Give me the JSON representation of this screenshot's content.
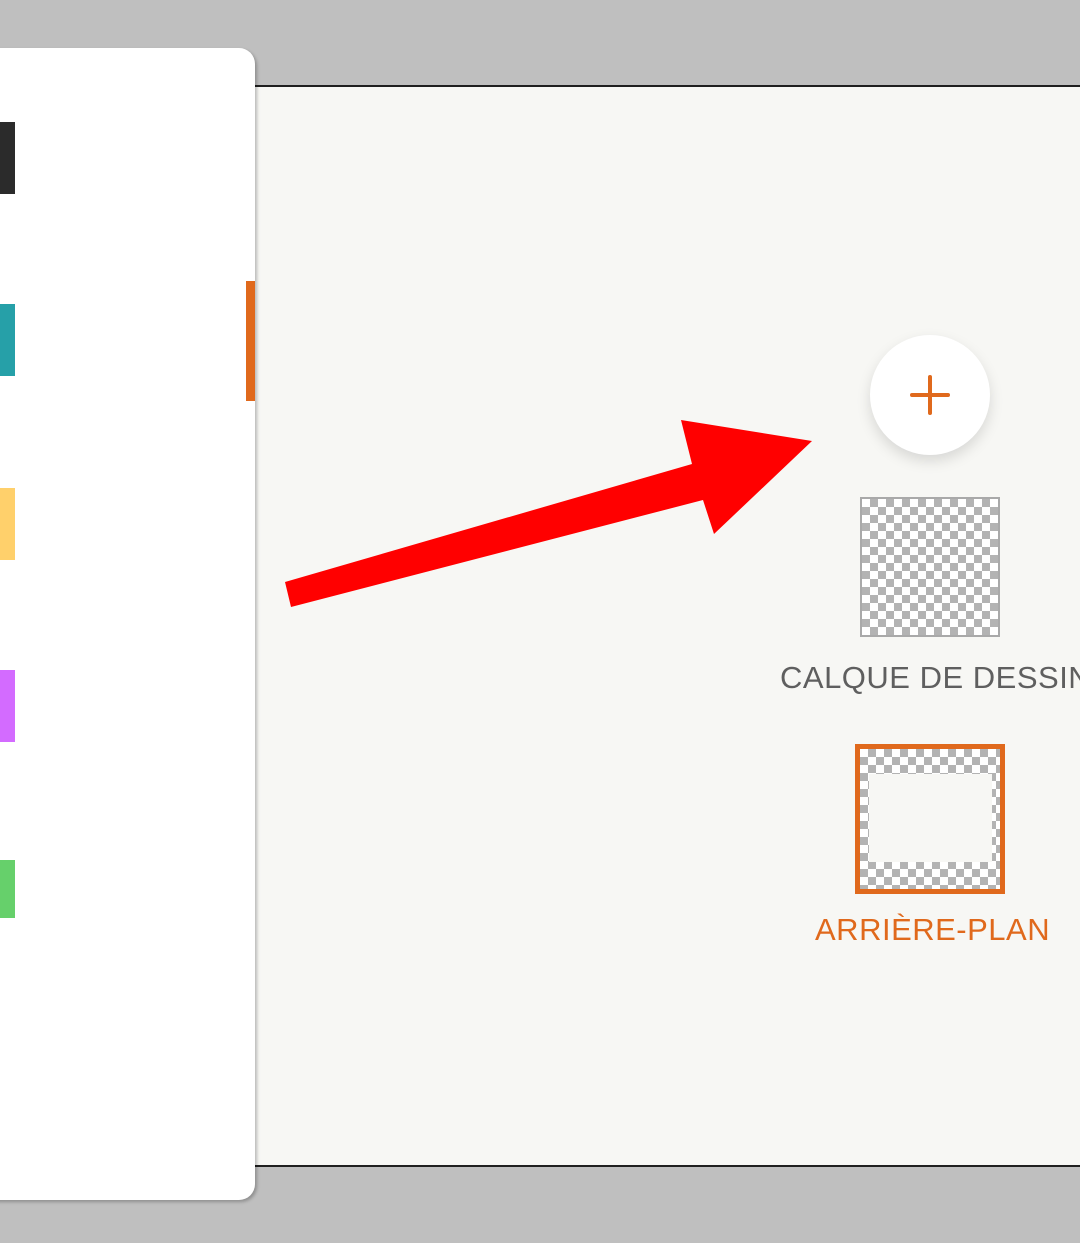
{
  "colors": {
    "accent": "#e0691c",
    "annotation_arrow": "#ff0000",
    "canvas_background": "#f7f7f4",
    "outer_background": "#bfbfbf"
  },
  "palette": {
    "swatches": [
      {
        "name": "dark-gray",
        "color": "#2b2b2b"
      },
      {
        "name": "teal",
        "color": "#26a0a8"
      },
      {
        "name": "yellow",
        "color": "#ffd06b"
      },
      {
        "name": "purple",
        "color": "#d36bff"
      },
      {
        "name": "green",
        "color": "#66d06b"
      }
    ]
  },
  "layers": {
    "add_button_icon": "plus-icon",
    "items": [
      {
        "label": "CALQUE DE DESSIN",
        "selected": false
      },
      {
        "label": "ARRIÈRE-PLAN",
        "selected": true
      }
    ]
  },
  "annotation": {
    "icon": "red-arrow-annotation"
  }
}
